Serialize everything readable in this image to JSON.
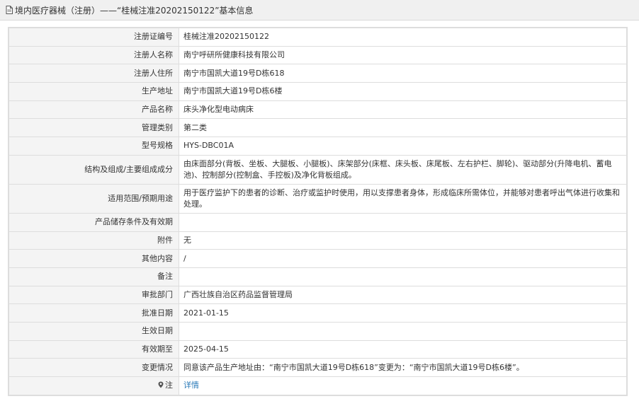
{
  "header": {
    "title": "境内医疗器械（注册）——“桂械注准20202150122”基本信息"
  },
  "rows": [
    {
      "label": "注册证编号",
      "value": "桂械注准20202150122"
    },
    {
      "label": "注册人名称",
      "value": "南宁呼研所健康科技有限公司"
    },
    {
      "label": "注册人住所",
      "value": "南宁市国凯大道19号D栋618"
    },
    {
      "label": "生产地址",
      "value": "南宁市国凯大道19号D栋6楼"
    },
    {
      "label": "产品名称",
      "value": "床头净化型电动病床"
    },
    {
      "label": "管理类别",
      "value": "第二类"
    },
    {
      "label": "型号规格",
      "value": "HYS-DBC01A"
    },
    {
      "label": "结构及组成/主要组成成分",
      "value": "由床面部分(背板、坐板、大腿板、小腿板)、床架部分(床框、床头板、床尾板、左右护栏、脚轮)、驱动部分(升降电机、蓄电池)、控制部分(控制盒、手控板)及净化背板组成。"
    },
    {
      "label": "适用范围/预期用途",
      "value": "用于医疗监护下的患者的诊断、治疗或监护时使用，用以支撑患者身体，形成临床所需体位，并能够对患者呼出气体进行收集和处理。"
    },
    {
      "label": "产品储存条件及有效期",
      "value": ""
    },
    {
      "label": "附件",
      "value": "无"
    },
    {
      "label": "其他内容",
      "value": "/"
    },
    {
      "label": "备注",
      "value": ""
    },
    {
      "label": "审批部门",
      "value": "广西壮族自治区药品监督管理局"
    },
    {
      "label": "批准日期",
      "value": "2021-01-15"
    },
    {
      "label": "生效日期",
      "value": ""
    },
    {
      "label": "有效期至",
      "value": "2025-04-15"
    },
    {
      "label": "变更情况",
      "value": "同意该产品生产地址由：“南宁市国凯大道19号D栋618”变更为：“南宁市国凯大道19号D栋6楼”。"
    },
    {
      "label": "注",
      "value": "详情",
      "icon": "pin-icon"
    }
  ],
  "colors": {
    "link": "#2a7ab8",
    "label_bg": "#f4f4f4",
    "border": "#dddddd"
  }
}
